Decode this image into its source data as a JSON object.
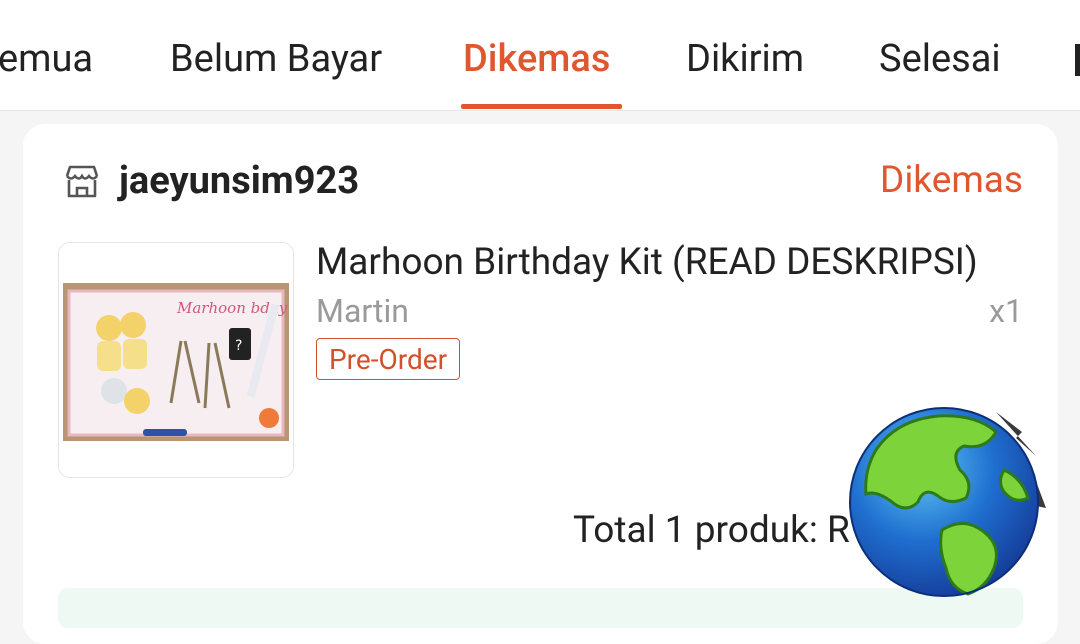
{
  "tabs": [
    {
      "label": "emua",
      "active": false
    },
    {
      "label": "Belum Bayar",
      "active": false
    },
    {
      "label": "Dikemas",
      "active": true
    },
    {
      "label": "Dikirim",
      "active": false
    },
    {
      "label": "Selesai",
      "active": false
    }
  ],
  "order": {
    "shop_icon": "store-icon",
    "shop_name": "jaeyunsim923",
    "status": "Dikemas",
    "product": {
      "title": "Marhoon Birthday Kit (READ DESKRIPSI)",
      "variant": "Martin",
      "quantity": "x1",
      "badge": "Pre-Order",
      "thumbnail_text": "Marhoon bday",
      "thumbnail_mystery": "?"
    },
    "total_label": "Total 1 produk:",
    "total_amount": "R"
  },
  "overlay_icon": "globe-icon",
  "colors": {
    "accent": "#e0562e",
    "text": "#222222",
    "muted": "#9a9a9a",
    "background": "#f5f5f5"
  }
}
